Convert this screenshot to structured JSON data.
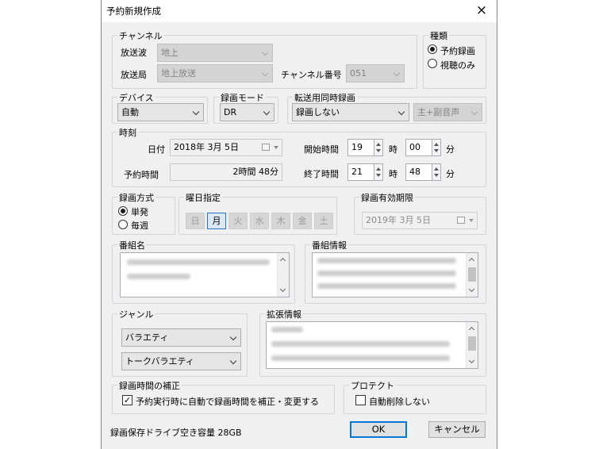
{
  "window": {
    "title": "予約新規作成",
    "close": "×"
  },
  "channel": {
    "legend": "チャンネル",
    "broadcast_wave_label": "放送波",
    "broadcast_wave_value": "地上",
    "station_label": "放送局",
    "station_value": "地上放送",
    "channel_no_label": "チャンネル番号",
    "channel_no_value": "051"
  },
  "kind": {
    "legend": "種類",
    "options": [
      "予約録画",
      "視聴のみ"
    ],
    "selected": 0
  },
  "device": {
    "legend": "デバイス",
    "value": "自動"
  },
  "rec_mode": {
    "legend": "録画モード",
    "value": "DR"
  },
  "transfer": {
    "legend": "転送用同時録画",
    "value": "録画しない",
    "audio_value": "主+副音声"
  },
  "time": {
    "legend": "時刻",
    "date_label": "日付",
    "date_value": "2018年  3月  5日",
    "duration_label": "予約時間",
    "duration_value": "2時間 48分",
    "start_label": "開始時間",
    "start_hour": "19",
    "start_min": "00",
    "end_label": "終了時間",
    "end_hour": "21",
    "end_min": "48",
    "hour_unit": "時",
    "min_unit": "分"
  },
  "rec_method": {
    "legend": "録画方式",
    "options": [
      "単発",
      "毎週"
    ],
    "selected": 0
  },
  "weekday": {
    "legend": "曜日指定",
    "days": [
      "日",
      "月",
      "火",
      "水",
      "木",
      "金",
      "土"
    ],
    "selected": 1
  },
  "expiry": {
    "legend": "録画有効期限",
    "value": "2019年  3月  5日"
  },
  "program_name": {
    "legend": "番組名"
  },
  "program_info": {
    "legend": "番組情報"
  },
  "genre": {
    "legend": "ジャンル",
    "primary": "バラエティ",
    "secondary": "トークバラエティ"
  },
  "ext_info": {
    "legend": "拡張情報"
  },
  "correction": {
    "legend": "録画時間の補正",
    "checkbox_label": "予約実行時に自動で録画時間を補正・変更する",
    "checked": true
  },
  "protect": {
    "legend": "プロテクト",
    "checkbox_label": "自動削除しない",
    "checked": false
  },
  "footer": {
    "free_space": "録画保存ドライブ空き容量 28GB",
    "ok": "OK",
    "cancel": "キャンセル"
  }
}
